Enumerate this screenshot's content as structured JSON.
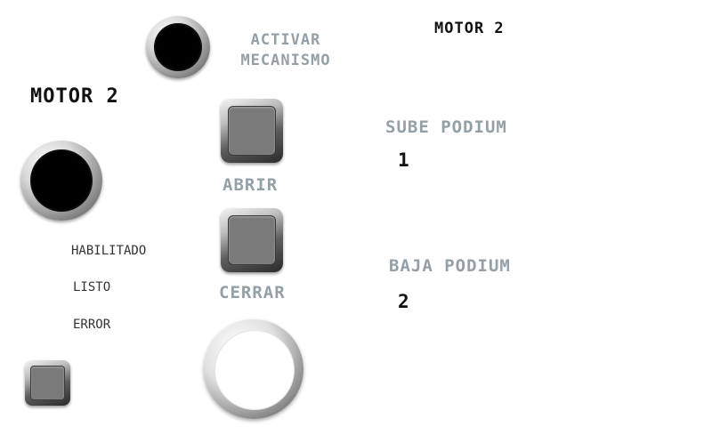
{
  "header": {
    "title_main": "MOTOR 2",
    "title_small": "MOTOR 2"
  },
  "controls": {
    "activar_label": "ACTIVAR\nMECANISMO",
    "abrir_label": "ABRIR",
    "cerrar_label": "CERRAR"
  },
  "podium": {
    "sube_label": "SUBE PODIUM",
    "sube_value": "1",
    "baja_label": "BAJA PODIUM",
    "baja_value": "2"
  },
  "status": {
    "habilitado": "HABILITADO",
    "listo": "LISTO",
    "error": "ERROR"
  },
  "icons": {
    "activate_led": "black-indicator-light",
    "motor_led": "black-indicator-light",
    "knob": "rotary-knob"
  }
}
